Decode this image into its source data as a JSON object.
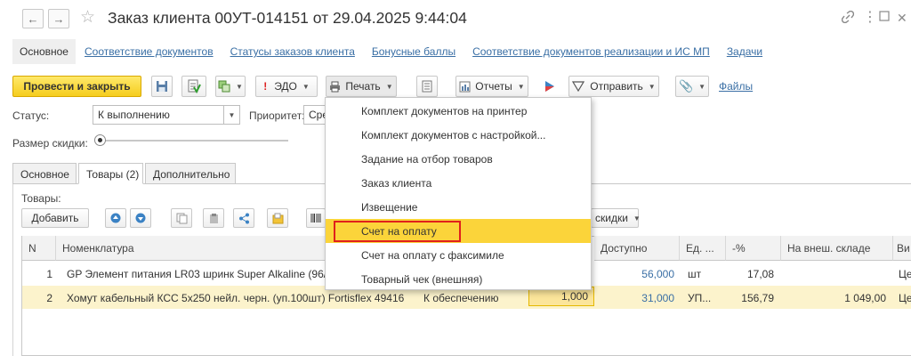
{
  "window": {
    "title": "Заказ клиента 00УТ-014151 от 29.04.2025 9:44:04"
  },
  "nav": {
    "main": "Основное",
    "links": [
      "Соответствие документов",
      "Статусы заказов клиента",
      "Бонусные баллы",
      "Соответствие документов реализации и ИС МП",
      "Задачи"
    ]
  },
  "toolbar": {
    "post_close": "Провести и закрыть",
    "edo": "ЭДО",
    "print": "Печать",
    "reports": "Отчеты",
    "send": "Отправить",
    "files": "Файлы"
  },
  "form": {
    "status_label": "Статус:",
    "status_value": "К выполнению",
    "priority_label": "Приоритет:",
    "priority_value": "Сре",
    "discount_label": "Размер скидки:"
  },
  "tabs": [
    "Основное",
    "Товары (2)",
    "Дополнительно"
  ],
  "goods": {
    "label": "Товары:",
    "add_button": "Добавить",
    "discounts_button": "скидки"
  },
  "table": {
    "headers": [
      "N",
      "Номенклатура",
      "Доступно",
      "Ед. ...",
      "-%",
      "На внеш. складе",
      "Ви"
    ],
    "rows": [
      {
        "n": "1",
        "name": "GP Элемент питания LR03 шринк Super Alkaline (96/3",
        "status": "",
        "qty": "",
        "available": "56,000",
        "unit": "шт",
        "pct": "17,08",
        "ext": "",
        "vid": "Це"
      },
      {
        "n": "2",
        "name": "Хомут кабельный КСС 5х250 нейл. черн. (уп.100шт) Fortisflex 49416",
        "status": "К обеспечению",
        "qty": "1,000",
        "available": "31,000",
        "unit": "УП...",
        "pct": "156,79",
        "ext": "1 049,00",
        "vid": "Це"
      }
    ]
  },
  "print_menu": {
    "items": [
      "Комплект документов на принтер",
      "Комплект документов с настройкой...",
      "Задание на отбор товаров",
      "Заказ клиента",
      "Извещение",
      "Счет на оплату",
      "Счет на оплату с факсимиле",
      "Товарный чек (внешняя)"
    ],
    "highlighted": "Счет на оплату"
  },
  "colors": {
    "primary_button": "#f5cd1e",
    "link": "#3a6fa5",
    "menu_highlight": "#fbd43a",
    "selected_row": "#fcf3cc",
    "outline": "#e0201c"
  },
  "icons": [
    "back-arrow-icon",
    "forward-arrow-icon",
    "star-icon",
    "link-icon",
    "more-icon",
    "expand-icon",
    "close-icon",
    "save-icon",
    "document-icon",
    "related-docs-icon",
    "exclamation-icon",
    "printer-icon",
    "list-icon",
    "reports-icon",
    "flag-icon",
    "send-icon",
    "paperclip-icon",
    "arrow-up-icon",
    "arrow-down-icon",
    "copy-icon",
    "paste-icon",
    "share-icon",
    "folder-icon",
    "barcode-icon"
  ]
}
